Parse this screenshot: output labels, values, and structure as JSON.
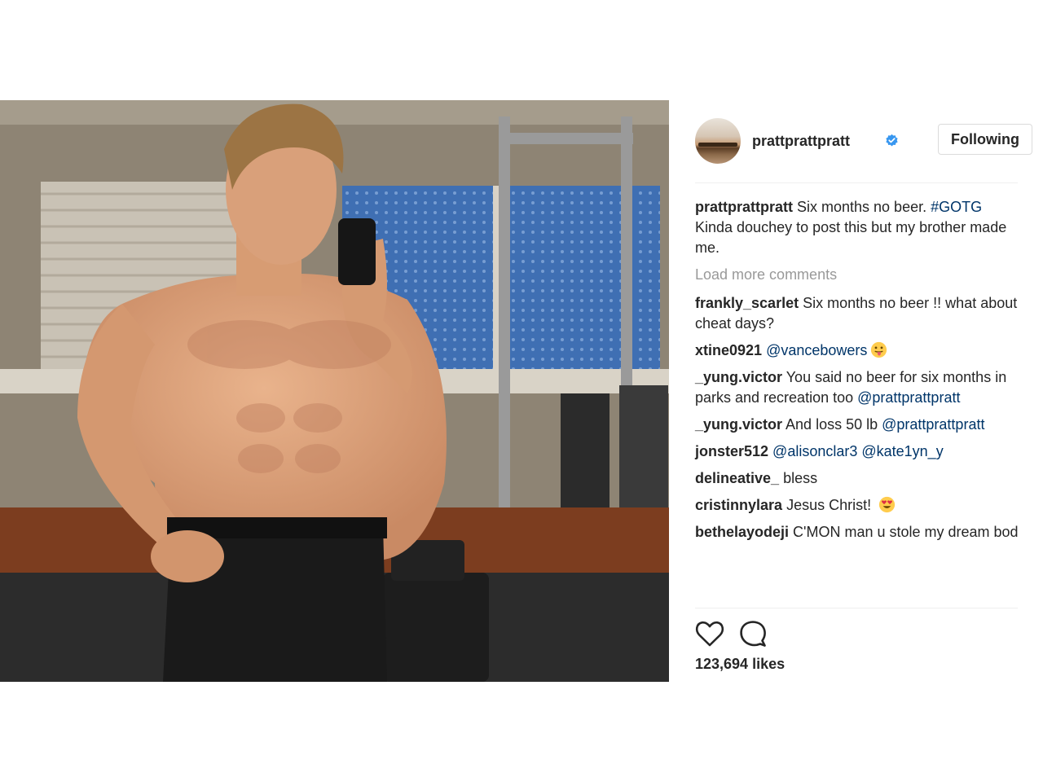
{
  "post": {
    "photo_alt": "",
    "author": {
      "username": "prattprattpratt",
      "verified": true,
      "follow_label": "Following"
    },
    "caption": {
      "username": "prattprattpratt",
      "text_part1": " Six months no beer. ",
      "hashtag": "#GOTG",
      "text_part2": " Kinda douchey to post this but my brother made me."
    },
    "load_more_label": "Load more comments",
    "comments": [
      {
        "username": "frankly_scarlet",
        "text": " Six months no beer !! what about cheat days?"
      },
      {
        "username": "xtine0921",
        "mention": " @vancebowers",
        "emoji": "tongue-out-face-icon"
      },
      {
        "username": "_yung.victor",
        "text": " You said no beer for six months in parks and recreation too ",
        "mention": "@prattprattpratt"
      },
      {
        "username": "_yung.victor",
        "text": " And loss 50 lb ",
        "mention": "@prattprattpratt"
      },
      {
        "username": "jonster512",
        "mention": " @alisonclar3 @kate1yn_y"
      },
      {
        "username": "delineative_",
        "text": " bless"
      },
      {
        "username": "cristinnylara",
        "text": " Jesus Christ! ",
        "emoji": "heart-eyes-face-icon"
      },
      {
        "username": "bethelayodeji",
        "text": " C'MON man u stole my dream bod"
      }
    ],
    "actions": {
      "like_icon": "heart-outline-icon",
      "comment_icon": "comment-bubble-icon"
    },
    "likes_label": "123,694 likes"
  },
  "colors": {
    "text": "#262626",
    "link": "#003569",
    "muted": "#999999",
    "verified": "#3897f0",
    "border": "#dbdbdb"
  }
}
